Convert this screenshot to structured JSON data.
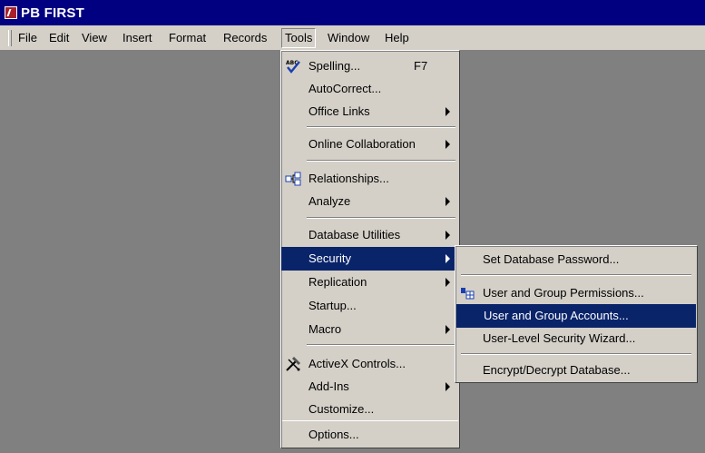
{
  "window": {
    "title": "PB FIRST"
  },
  "menubar": {
    "items": [
      "File",
      "Edit",
      "View",
      "Insert",
      "Format",
      "Records",
      "Tools",
      "Window",
      "Help"
    ]
  },
  "tools_menu": {
    "items": [
      {
        "label": "Spelling...",
        "accelerator": "F7",
        "icon": "spelling-icon"
      },
      {
        "label": "AutoCorrect..."
      },
      {
        "label": "Office Links",
        "submenu": true
      },
      {
        "label": "Online Collaboration",
        "submenu": true
      },
      {
        "label": "Relationships...",
        "icon": "relationships-icon"
      },
      {
        "label": "Analyze",
        "submenu": true
      },
      {
        "label": "Database Utilities",
        "submenu": true
      },
      {
        "label": "Security",
        "submenu": true,
        "highlighted": true
      },
      {
        "label": "Replication",
        "submenu": true
      },
      {
        "label": "Startup..."
      },
      {
        "label": "Macro",
        "submenu": true
      },
      {
        "label": "ActiveX Controls...",
        "icon": "activex-icon"
      },
      {
        "label": "Add-Ins",
        "submenu": true
      },
      {
        "label": "Customize..."
      },
      {
        "label": "Options..."
      }
    ]
  },
  "security_submenu": {
    "items": [
      {
        "label": "Set Database Password..."
      },
      {
        "label": "User and Group Permissions...",
        "icon": "permissions-icon"
      },
      {
        "label": "User and Group Accounts...",
        "highlighted": true
      },
      {
        "label": "User-Level Security Wizard..."
      },
      {
        "label": "Encrypt/Decrypt Database..."
      }
    ]
  },
  "colors": {
    "title_bar": "#000080",
    "menu_bg": "#d4d0c8",
    "highlight": "#0a246a",
    "workspace": "#808080"
  }
}
